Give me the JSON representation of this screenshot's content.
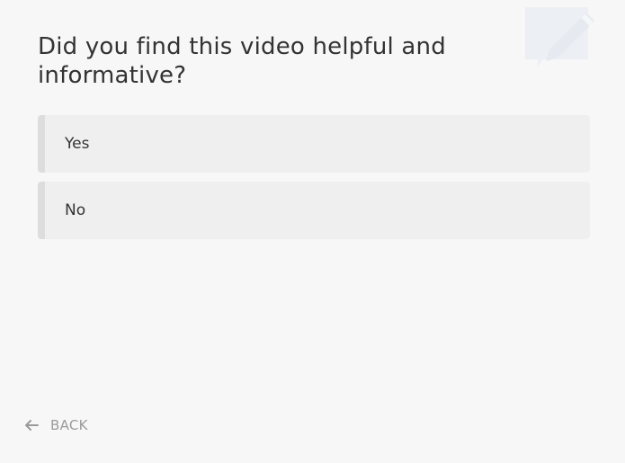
{
  "survey": {
    "question": "Did you find this video helpful and informative?",
    "options": [
      {
        "label": "Yes"
      },
      {
        "label": "No"
      }
    ]
  },
  "navigation": {
    "back_label": "BACK"
  },
  "icons": {
    "decoration": "speech-bubble-pencil-icon",
    "back": "arrow-left-icon"
  },
  "colors": {
    "background": "#f7f7f7",
    "option_background": "#efefef",
    "option_accent": "#dddddd",
    "text": "#333333",
    "muted_text": "#9a9a9a",
    "decoration": "#e9ecf1"
  }
}
